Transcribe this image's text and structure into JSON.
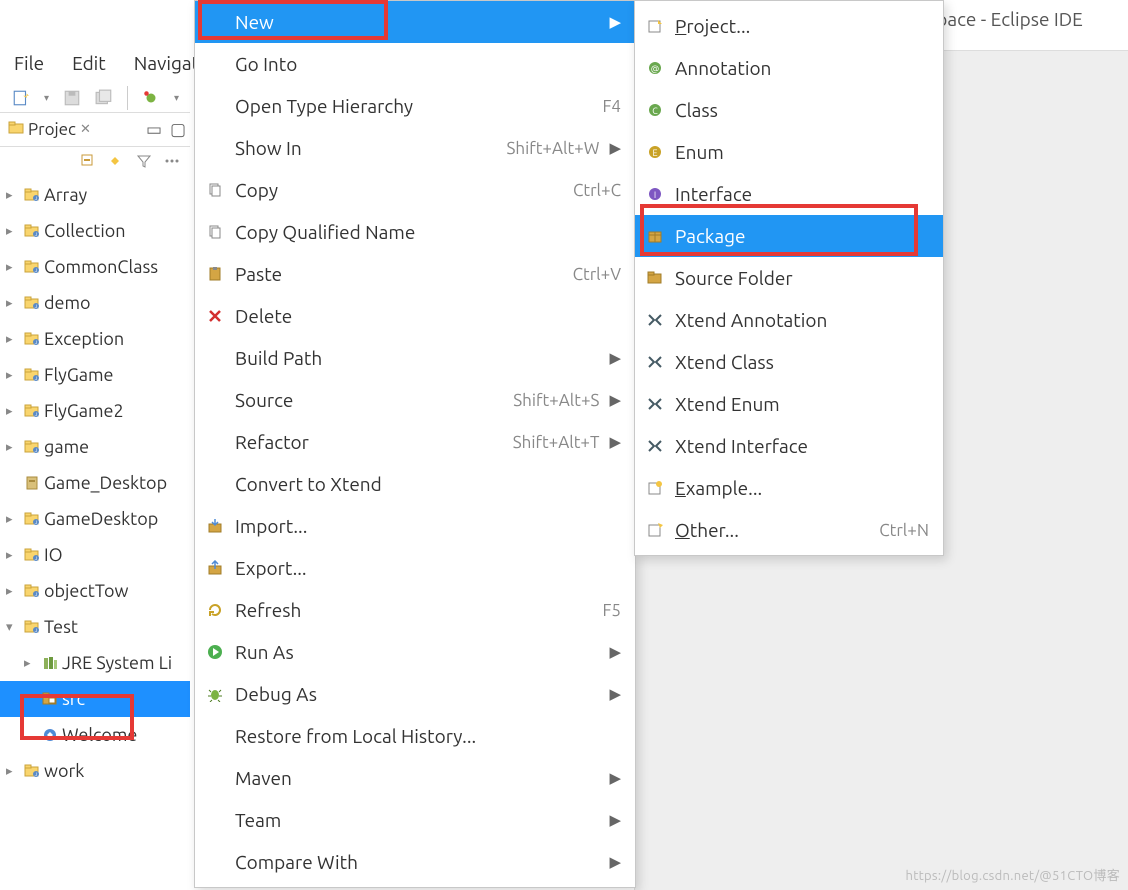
{
  "window": {
    "title_suffix": "space - Eclipse IDE"
  },
  "menubar": {
    "file": "File",
    "edit": "Edit",
    "navigate": "Navigate"
  },
  "project_explorer": {
    "tab_label": "Projec",
    "items": [
      {
        "label": "Array",
        "kind": "project",
        "expandable": true
      },
      {
        "label": "Collection",
        "kind": "project",
        "expandable": true
      },
      {
        "label": "CommonClass",
        "kind": "project",
        "expandable": true
      },
      {
        "label": "demo",
        "kind": "project",
        "expandable": true
      },
      {
        "label": "Exception",
        "kind": "project",
        "expandable": true
      },
      {
        "label": "FlyGame",
        "kind": "project",
        "expandable": true
      },
      {
        "label": "FlyGame2",
        "kind": "project",
        "expandable": true
      },
      {
        "label": "game",
        "kind": "project",
        "expandable": true
      },
      {
        "label": "Game_Desktop",
        "kind": "jar",
        "expandable": false
      },
      {
        "label": "GameDesktop",
        "kind": "project",
        "expandable": true
      },
      {
        "label": "IO",
        "kind": "project",
        "expandable": true
      },
      {
        "label": "objectTow",
        "kind": "project",
        "expandable": true
      },
      {
        "label": "Test",
        "kind": "project",
        "expandable": true,
        "expanded": true
      },
      {
        "label": "JRE System Li",
        "kind": "library",
        "depth": 1,
        "expandable": true
      },
      {
        "label": "src",
        "kind": "src-folder",
        "depth": 1,
        "selected": true,
        "highlight": true
      },
      {
        "label": "Welcome",
        "kind": "welcome",
        "depth": 1
      },
      {
        "label": "work",
        "kind": "project",
        "expandable": true
      }
    ]
  },
  "context_menu": {
    "items": [
      {
        "label": "New",
        "submenu": true,
        "selected": true,
        "highlight": true
      },
      {
        "label": "Go Into"
      },
      {
        "label": "Open Type Hierarchy",
        "shortcut": "F4"
      },
      {
        "label": "Show In",
        "shortcut": "Shift+Alt+W",
        "submenu": true
      },
      {
        "label": "Copy",
        "icon": "copy",
        "shortcut": "Ctrl+C"
      },
      {
        "label": "Copy Qualified Name",
        "icon": "copy"
      },
      {
        "label": "Paste",
        "icon": "paste",
        "shortcut": "Ctrl+V"
      },
      {
        "label": "Delete",
        "icon": "delete"
      },
      {
        "label": "Build Path",
        "submenu": true
      },
      {
        "label": "Source",
        "shortcut": "Shift+Alt+S",
        "submenu": true
      },
      {
        "label": "Refactor",
        "shortcut": "Shift+Alt+T",
        "submenu": true
      },
      {
        "label": "Convert to Xtend"
      },
      {
        "label": "Import...",
        "icon": "import"
      },
      {
        "label": "Export...",
        "icon": "export"
      },
      {
        "label": "Refresh",
        "icon": "refresh",
        "shortcut": "F5"
      },
      {
        "label": "Run As",
        "icon": "run",
        "submenu": true
      },
      {
        "label": "Debug As",
        "icon": "debug",
        "submenu": true
      },
      {
        "label": "Restore from Local History..."
      },
      {
        "label": "Maven",
        "submenu": true
      },
      {
        "label": "Team",
        "submenu": true
      },
      {
        "label": "Compare With",
        "submenu": true
      }
    ]
  },
  "new_submenu": {
    "items": [
      {
        "label": "Project...",
        "icon": "project-new",
        "mnemonic": "P"
      },
      {
        "label": "Annotation",
        "icon": "annotation"
      },
      {
        "label": "Class",
        "icon": "class"
      },
      {
        "label": "Enum",
        "icon": "enum"
      },
      {
        "label": "Interface",
        "icon": "interface"
      },
      {
        "label": "Package",
        "icon": "package",
        "selected": true,
        "highlight": true
      },
      {
        "label": "Source Folder",
        "icon": "source-folder"
      },
      {
        "label": "Xtend Annotation",
        "icon": "xtend"
      },
      {
        "label": "Xtend Class",
        "icon": "xtend"
      },
      {
        "label": "Xtend Enum",
        "icon": "xtend"
      },
      {
        "label": "Xtend Interface",
        "icon": "xtend"
      },
      {
        "label": "Example...",
        "icon": "example",
        "mnemonic": "E"
      },
      {
        "label": "Other...",
        "icon": "other",
        "mnemonic": "O",
        "shortcut": "Ctrl+N"
      }
    ]
  },
  "watermark": "https://blog.csdn.net/@51CTO博客"
}
